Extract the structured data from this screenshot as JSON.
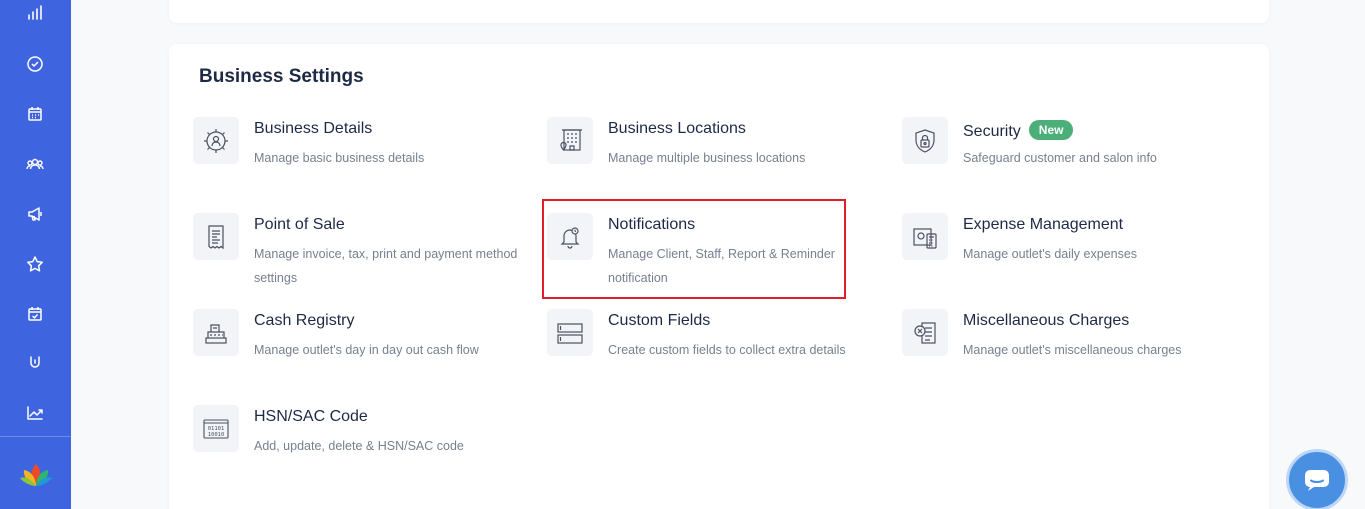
{
  "sidebar": {
    "icons": [
      "bar-chart-icon",
      "check-circle-icon",
      "calendar-icon",
      "users-icon",
      "megaphone-icon",
      "star-icon",
      "calendar-check-icon",
      "stopwatch-icon",
      "trend-chart-icon"
    ],
    "accent": "#3f64e0"
  },
  "section": {
    "title": "Business Settings"
  },
  "items": [
    {
      "title": "Business Details",
      "desc": "Manage basic business details"
    },
    {
      "title": "Business Locations",
      "desc": "Manage multiple business locations"
    },
    {
      "title": "Security",
      "badge": "New",
      "desc": "Safeguard customer and salon info"
    },
    {
      "title": "Point of Sale",
      "desc": "Manage invoice, tax, print and payment method settings"
    },
    {
      "title": "Notifications",
      "desc": "Manage Client, Staff, Report & Reminder notification"
    },
    {
      "title": "Expense Management",
      "desc": "Manage outlet's daily expenses"
    },
    {
      "title": "Cash Registry",
      "desc": "Manage outlet's day in day out cash flow"
    },
    {
      "title": "Custom Fields",
      "desc": "Create custom fields to collect extra details"
    },
    {
      "title": "Miscellaneous Charges",
      "desc": "Manage outlet's miscellaneous charges"
    },
    {
      "title": "HSN/SAC Code",
      "desc": "Add, update, delete & HSN/SAC code"
    }
  ],
  "colors": {
    "highlight": "#e11d2a",
    "badge": "#4caf7a",
    "chat": "#4a90e2"
  }
}
